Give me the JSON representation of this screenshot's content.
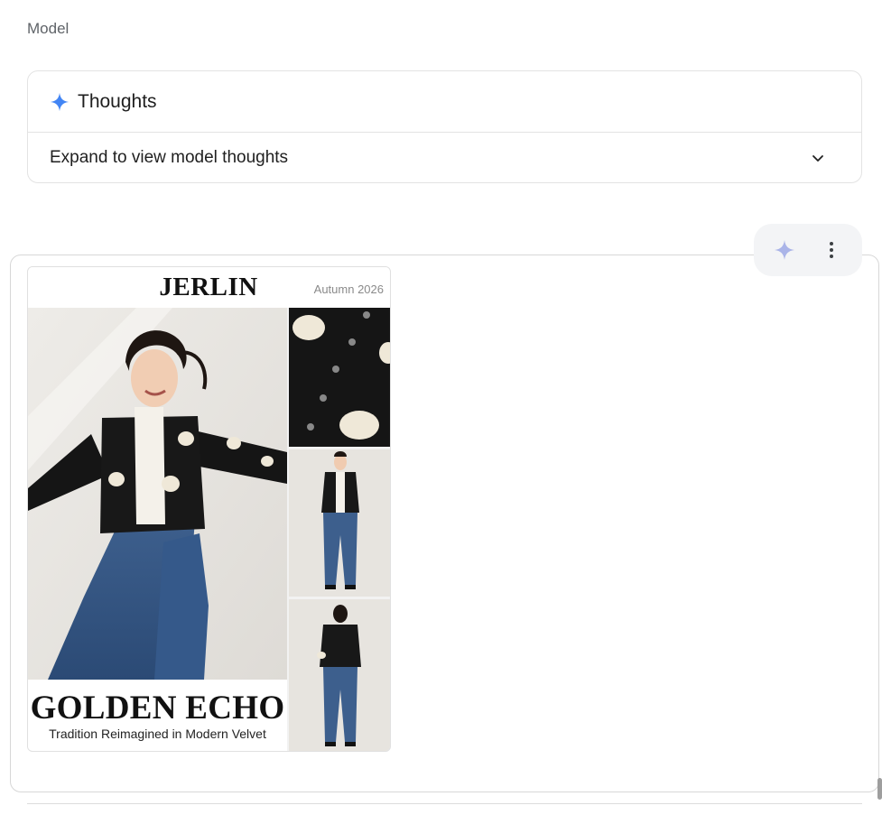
{
  "message": {
    "role_label": "Model"
  },
  "thoughts": {
    "title": "Thoughts",
    "expand_label": "Expand to view model thoughts",
    "icon": "sparkle-icon",
    "expand_icon": "chevron-down-icon",
    "accent": "#4285f4"
  },
  "response_actions": {
    "items": [
      {
        "icon": "sparkle-icon",
        "color": "#aab4e8"
      },
      {
        "icon": "more-vert-icon",
        "color": "#3c4043"
      }
    ]
  },
  "generated_image": {
    "brand": "JERLIN",
    "season": "Autumn 2026",
    "headline": "GOLDEN ECHO",
    "tagline": "Tradition Reimagined in Modern Velvet"
  }
}
